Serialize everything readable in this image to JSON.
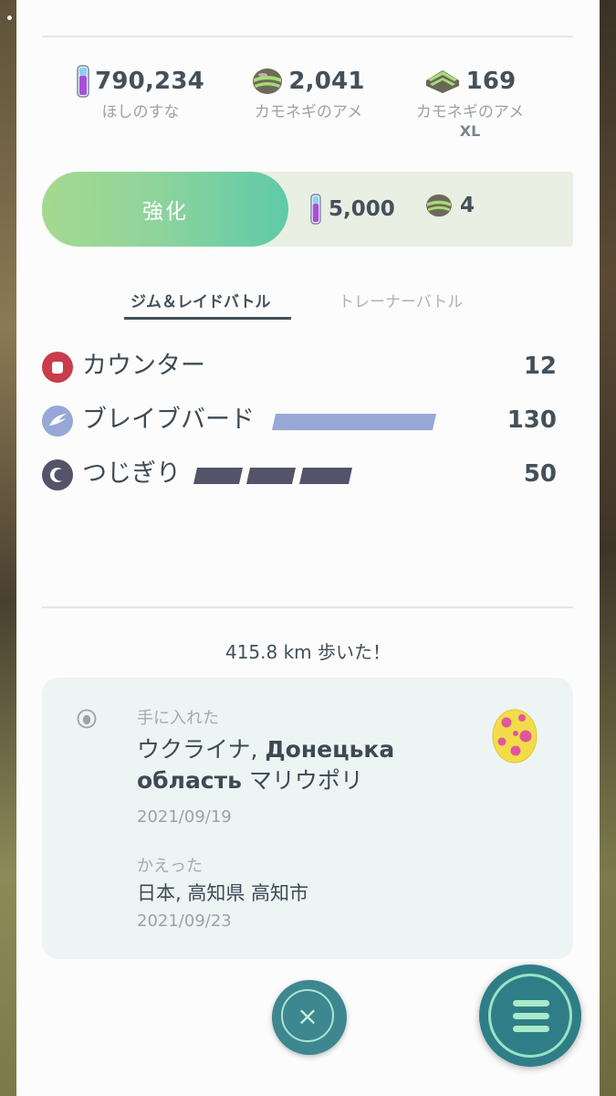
{
  "resources": [
    {
      "icon": "stardust-icon",
      "value": "790,234",
      "label": "ほしのすな",
      "label2": ""
    },
    {
      "icon": "candy-icon",
      "value": "2,041",
      "label": "カモネギのアメ",
      "label2": ""
    },
    {
      "icon": "candy-xl-icon",
      "value": "169",
      "label": "カモネギのアメ",
      "label2": "XL"
    }
  ],
  "power_up": {
    "label": "強化",
    "stardust_cost": "5,000",
    "candy_cost": "4"
  },
  "tabs": {
    "gym_raid": "ジム＆レイドバトル",
    "trainer": "トレーナーバトル"
  },
  "moves": [
    {
      "type": "fighting-type-icon",
      "name": "カウンター",
      "power": "12",
      "color": "#c83c4c",
      "energy_segments": 0
    },
    {
      "type": "flying-type-icon",
      "name": "ブレイブバード",
      "power": "130",
      "color": "#98a8d6",
      "energy_segments": 1
    },
    {
      "type": "dark-type-icon",
      "name": "つじぎり",
      "power": "50",
      "color": "#55536a",
      "energy_segments": 3
    }
  ],
  "walked": "415.8 km 歩いた！",
  "caught": {
    "label": "手に入れた",
    "location_jp1": "ウクライナ, ",
    "location_ru1": "Донецька",
    "location_ru2": "область",
    "location_jp2": " マリウポリ",
    "date": "2021/09/19"
  },
  "hatched": {
    "label": "かえった",
    "location": "日本, 高知県 高知市",
    "date": "2021/09/23"
  },
  "buttons": {
    "close": "×"
  }
}
